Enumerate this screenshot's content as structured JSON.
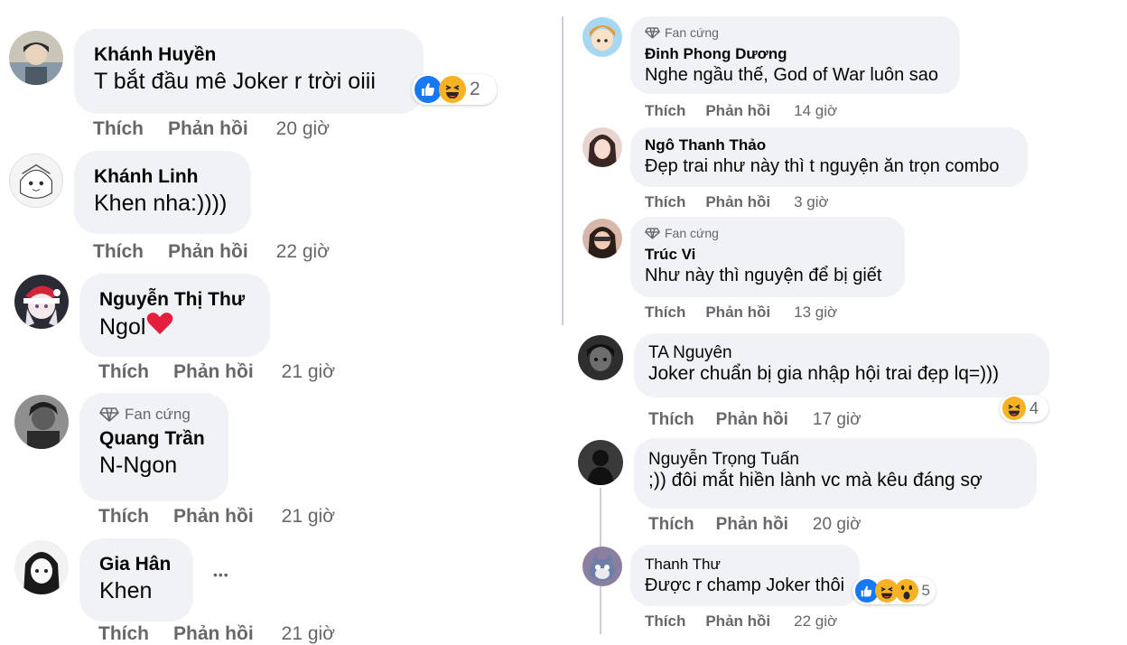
{
  "labels": {
    "like": "Thích",
    "reply": "Phản hồi",
    "fan_badge": "Fan cứng",
    "more": "•••"
  },
  "left_comments": [
    {
      "name": "Khánh Huyền",
      "text": "T bắt đầu mê Joker r trời oiii",
      "time": "20 giờ",
      "reaction_count": "2"
    },
    {
      "name": "Khánh Linh",
      "text": "Khen nha:))))",
      "time": "22 giờ"
    },
    {
      "name": "Nguyễn Thị Thư",
      "text": "Ngol",
      "time": "21 giờ"
    },
    {
      "name": "Quang Trần",
      "text": "N-Ngon",
      "time": "21 giờ",
      "badge": "Fan cứng"
    },
    {
      "name": "Gia Hân",
      "text": "Khen",
      "time": "21 giờ"
    }
  ],
  "right_comments": [
    {
      "name": "Đinh Phong Dương",
      "text": "Nghe ngầu thế, God of War luôn sao",
      "time": "14 giờ",
      "badge": "Fan cứng"
    },
    {
      "name": "Ngô Thanh Thảo",
      "text": "Đẹp trai như này thì t nguyện ăn trọn combo",
      "time": "3 giờ"
    },
    {
      "name": "Trúc Vi",
      "text": "Như này thì nguyện để bị giết",
      "time": "13 giờ",
      "badge": "Fan cứng"
    },
    {
      "name": "TA Nguyên",
      "text": "Joker chuẩn bị gia nhập hội trai đẹp lq=)))",
      "time": "17 giờ",
      "reaction_count": "4"
    },
    {
      "name": "Nguyễn Trọng Tuấn",
      "text": ";)) đôi mắt hiền lành vc mà kêu đáng sợ",
      "time": "20 giờ"
    },
    {
      "name": "Thanh Thư",
      "text": "Được r champ Joker thôi",
      "time": "22 giờ",
      "reaction_count": "5"
    }
  ],
  "colors": {
    "bubble": "#f0f2f5",
    "secondary_text": "#65676b",
    "like_blue": "#1877f2",
    "haha_yellow": "#f7b125",
    "heart_red": "#e41e3f",
    "thread_line": "#ccd0d5"
  }
}
